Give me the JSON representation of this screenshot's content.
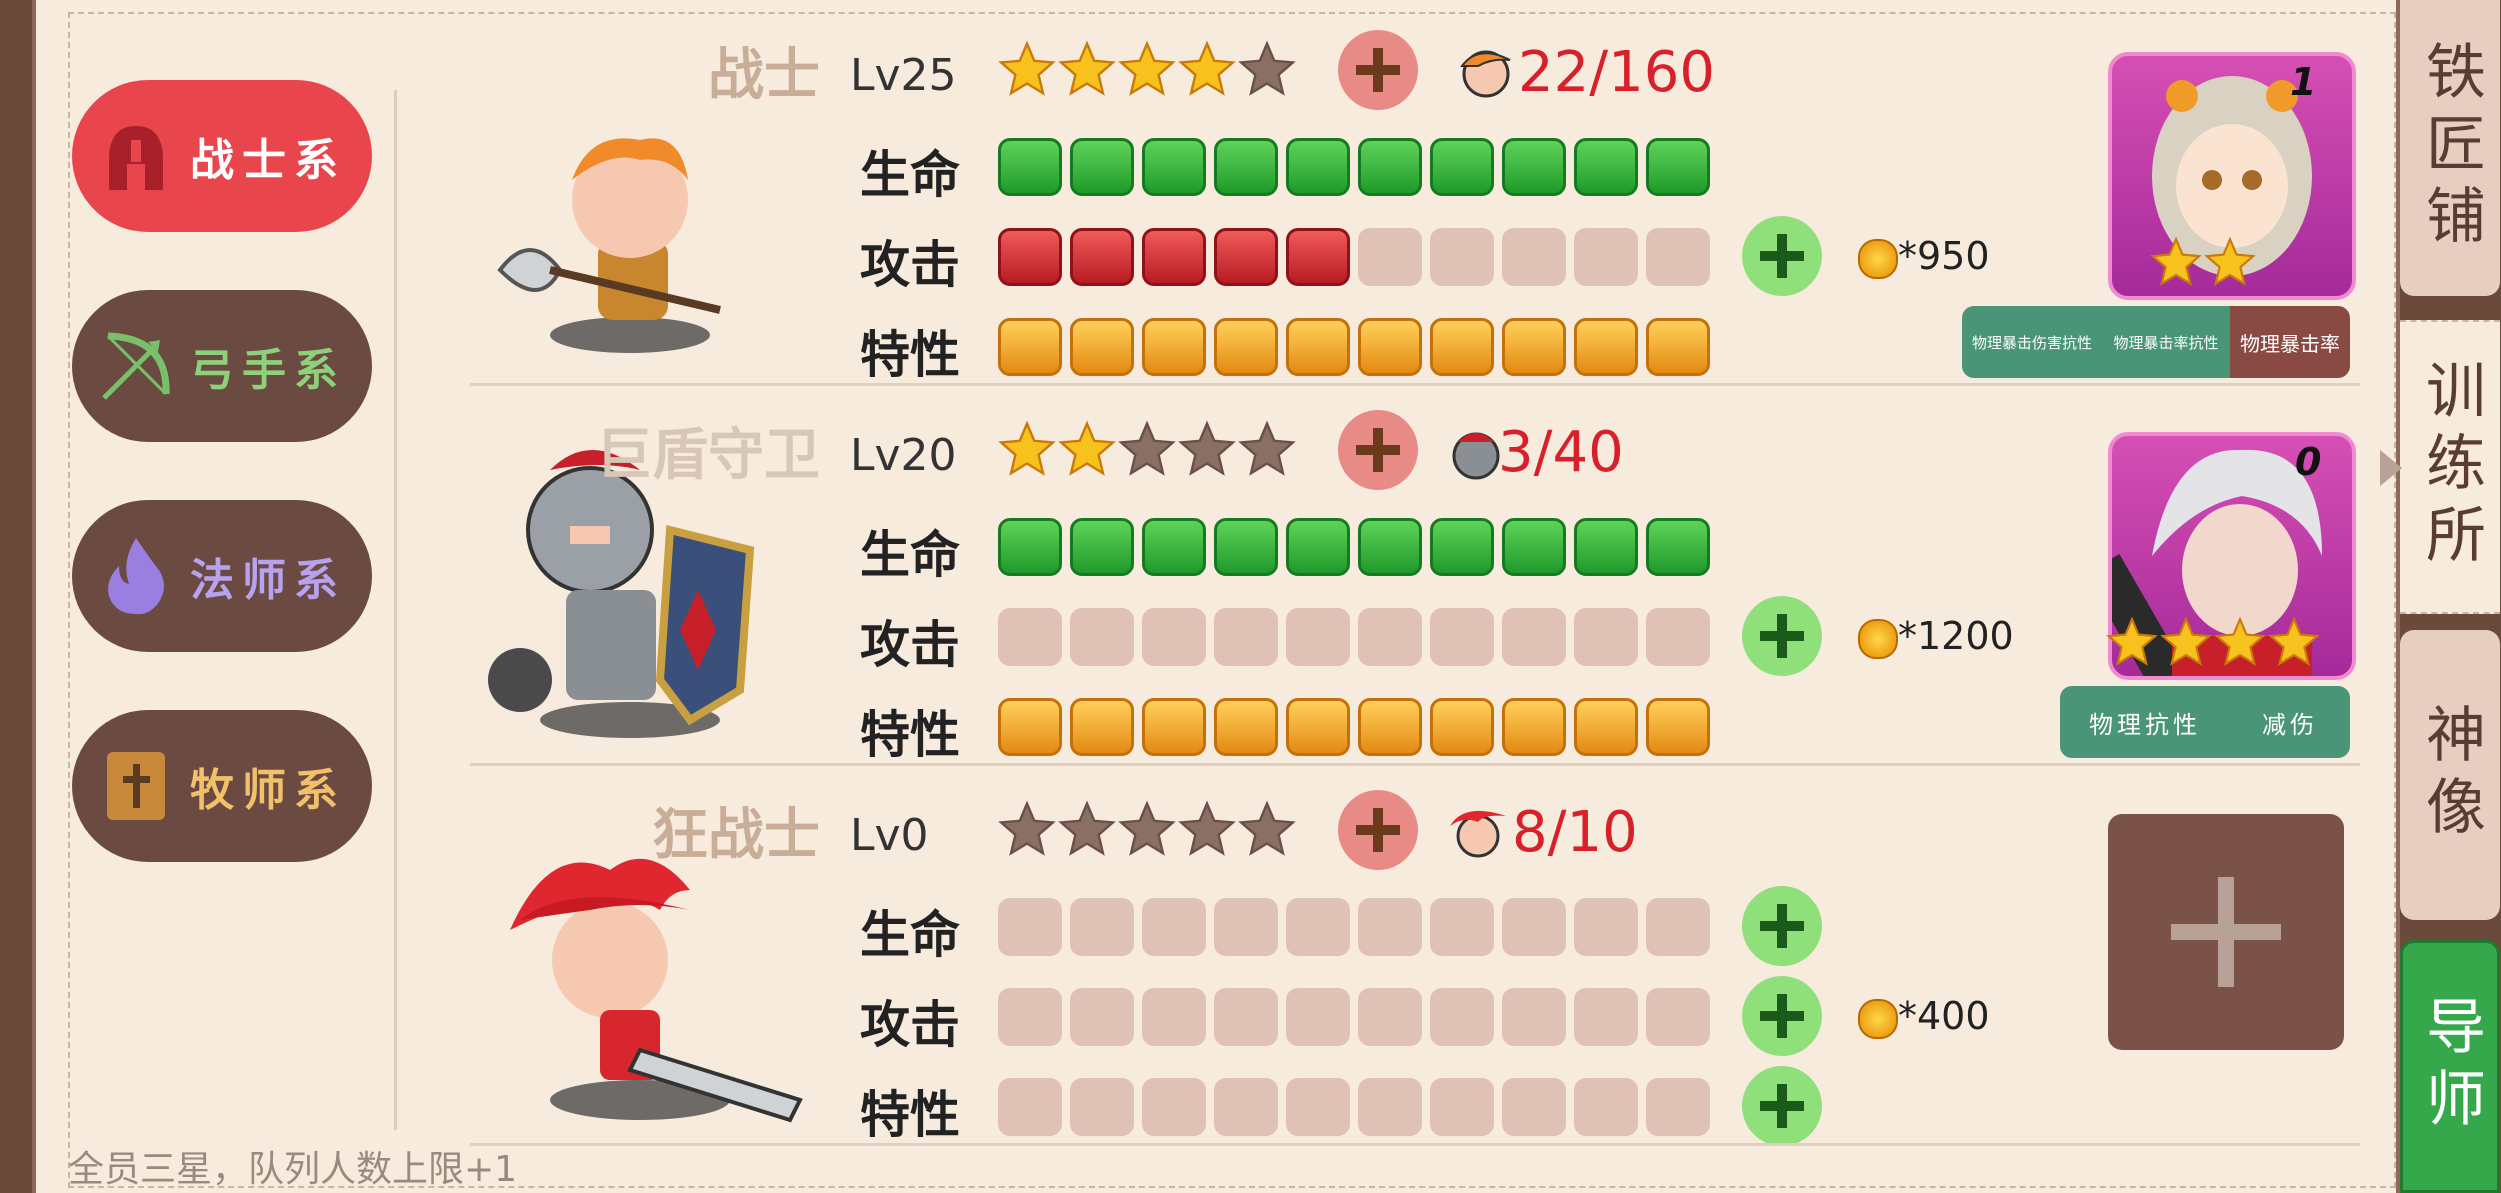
{
  "categories": [
    {
      "label": "战士系",
      "icon": "helmet-icon",
      "active": true
    },
    {
      "label": "弓手系",
      "icon": "bow-icon",
      "active": false
    },
    {
      "label": "法师系",
      "icon": "fire-icon",
      "active": false
    },
    {
      "label": "牧师系",
      "icon": "book-icon",
      "active": false
    }
  ],
  "stat_labels": {
    "hp": "生命",
    "atk": "攻击",
    "trait": "特性"
  },
  "heroes": [
    {
      "name": "战士",
      "level": "Lv25",
      "stars": 4,
      "shards": "22/160",
      "hp": 10,
      "atk": 5,
      "trait": 10,
      "cost": "*950"
    },
    {
      "name": "巨盾守卫",
      "level": "Lv20",
      "stars": 2,
      "shards": "3/40",
      "hp": 10,
      "atk": 0,
      "trait": 10,
      "cost": "*1200"
    },
    {
      "name": "狂战士",
      "level": "Lv0",
      "stars": 0,
      "shards": "8/10",
      "hp": 0,
      "atk": 0,
      "trait": 0,
      "cost": "*400"
    }
  ],
  "mentors": [
    {
      "badge": "1",
      "stars": 2,
      "tags": [
        "物理暴击伤害抗性",
        "物理暴击率抗性",
        "物理暴击率"
      ]
    },
    {
      "badge": "0",
      "stars": 4,
      "tags": [
        "物理抗性",
        "减伤"
      ]
    }
  ],
  "side_tabs": [
    {
      "label": "铁匠铺"
    },
    {
      "label": "训练所"
    },
    {
      "label": "神像"
    },
    {
      "label": "导师"
    }
  ],
  "footer_text": "全员三星，队列人数上限+1",
  "colors": {
    "active_category": "#e8454d",
    "category_bg": "#6b4a42",
    "hp": "#2fb43a",
    "atk": "#d8262e",
    "trait": "#f0a020"
  }
}
